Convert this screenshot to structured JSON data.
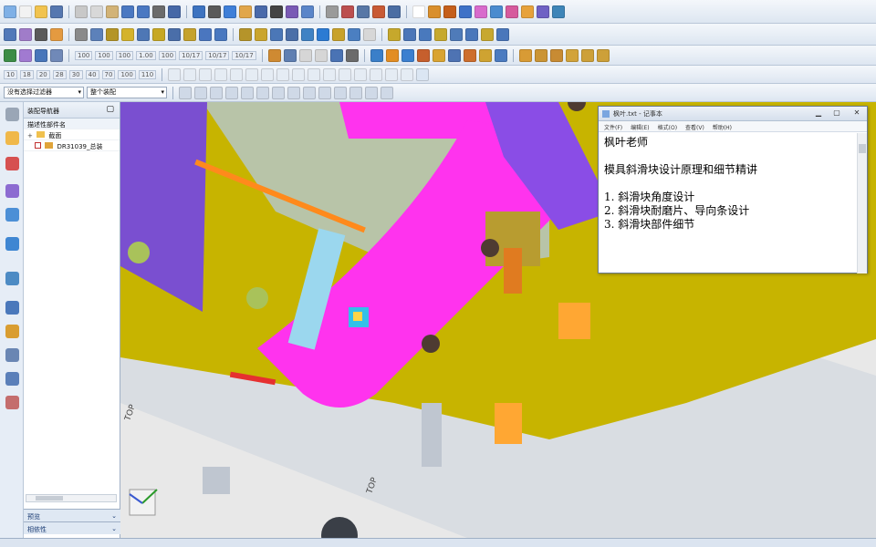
{
  "toolbar": {
    "zoom_values": [
      "100",
      "100",
      "100",
      "1.00",
      "100",
      "10/17",
      "10/17",
      "10/17"
    ],
    "row4_numbers": [
      "10",
      "18",
      "20",
      "28",
      "30",
      "40",
      "70",
      "100",
      "110"
    ],
    "selection_filter": "没有选择过滤器",
    "assembly_filter": "整个装配"
  },
  "nav_panel": {
    "title": "装配导航器",
    "column_header": "描述性部件名",
    "items": [
      {
        "label": "截面"
      },
      {
        "label": "DR31039_总装"
      }
    ],
    "footer_preview": "预览",
    "footer_dependency": "相依性"
  },
  "notepad": {
    "title": "枫叶.txt - 记事本",
    "menu": [
      "文件(F)",
      "编辑(E)",
      "格式(O)",
      "查看(V)",
      "帮助(H)"
    ],
    "lines": [
      "枫叶老师",
      "",
      "模具斜滑块设计原理和细节精讲",
      "",
      "1. 斜滑块角度设计",
      "2. 斜滑块耐磨片、导向条设计",
      "3. 斜滑块部件细节"
    ]
  },
  "viewport": {
    "labels": [
      "TOP",
      "TOP"
    ]
  },
  "colors": {
    "magenta": "#ff33ee",
    "olive": "#c7b400",
    "purple": "#8a4de6",
    "light_blue": "#9bd7ee",
    "plate_gray": "#d9dde2",
    "olive_pin": "#a9c25a",
    "orange": "#ff8a1c"
  }
}
